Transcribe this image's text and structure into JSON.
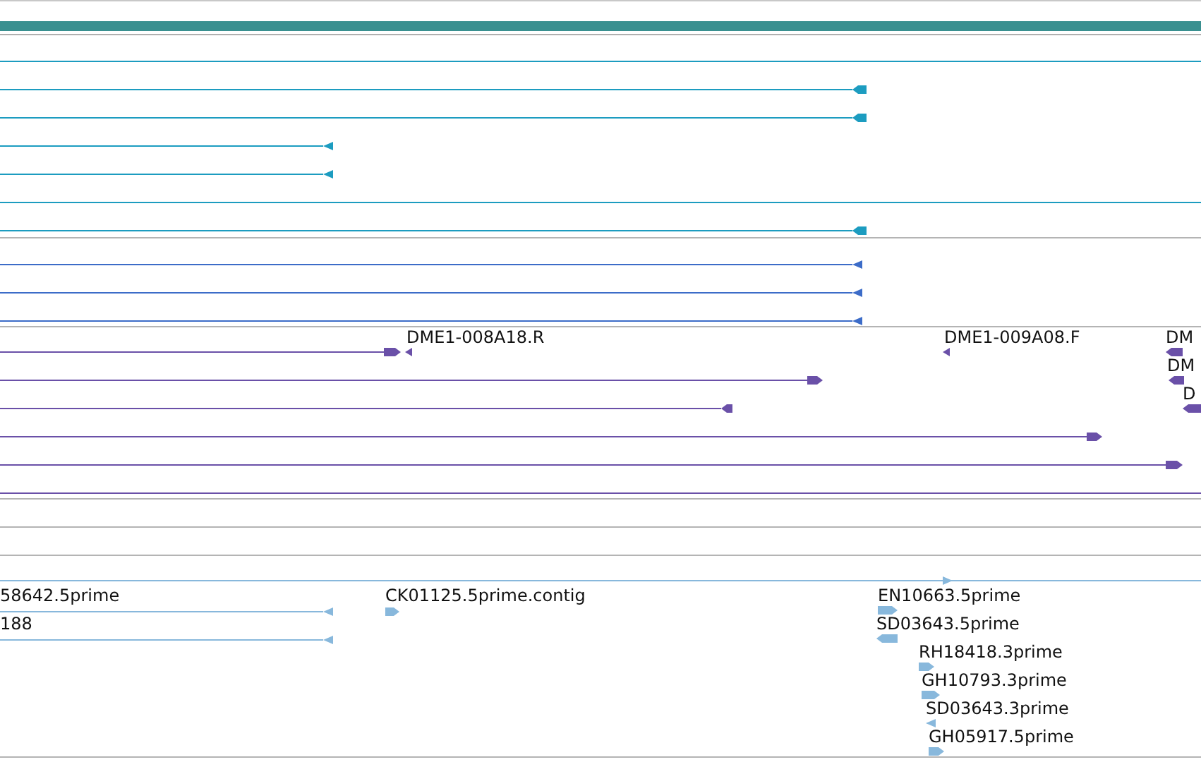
{
  "tracks": [
    {
      "color": "#1c9cc0",
      "features": [
        {
          "reverse": true
        },
        {
          "reverse": true
        },
        {
          "reverse": true
        },
        {
          "reverse": true
        },
        {
          "reverse": true
        }
      ]
    },
    {
      "color": "#3c6cc8",
      "features": [
        {
          "reverse": true
        },
        {
          "reverse": true
        },
        {
          "reverse": true
        }
      ]
    },
    {
      "color": "#6a50a8",
      "features": [
        {
          "reverse": false
        },
        {
          "reverse": true,
          "label": "DME1-008A18.R"
        },
        {
          "reverse": true,
          "label": "DME1-009A08.F"
        },
        {
          "reverse": true,
          "label": "DM"
        },
        {
          "reverse": false
        },
        {
          "reverse": true,
          "label": "DM"
        },
        {
          "reverse": true
        },
        {
          "reverse": true,
          "label": "D"
        },
        {
          "reverse": false
        },
        {
          "reverse": false
        }
      ]
    },
    {
      "color": "#88b8dc",
      "features": [
        {
          "reverse": false
        },
        {
          "reverse": true,
          "label": "58642.5prime"
        },
        {
          "reverse": true,
          "label": "188"
        },
        {
          "reverse": false,
          "label": "CK01125.5prime.contig"
        },
        {
          "reverse": false,
          "label": "EN10663.5prime"
        },
        {
          "reverse": true,
          "label": "SD03643.5prime"
        },
        {
          "reverse": false,
          "label": "RH18418.3prime"
        },
        {
          "reverse": false,
          "label": "GH10793.3prime"
        },
        {
          "reverse": true,
          "label": "SD03643.3prime"
        },
        {
          "reverse": false,
          "label": "GH05917.5prime"
        }
      ]
    }
  ]
}
